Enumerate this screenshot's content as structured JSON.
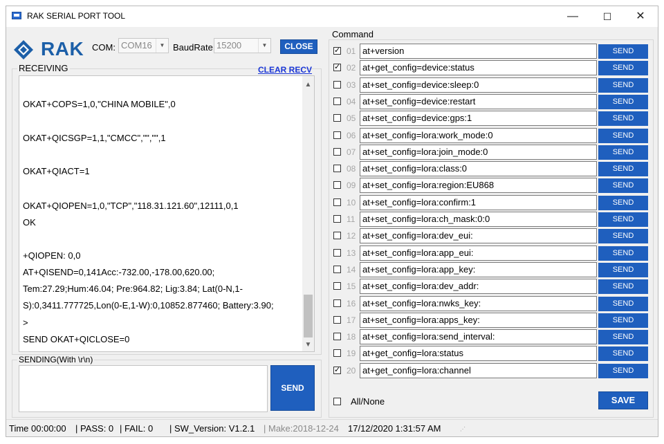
{
  "window": {
    "title": "RAK SERIAL PORT TOOL",
    "controls": {
      "minimize": "—",
      "maximize": "☐",
      "close": "✕"
    }
  },
  "toolbar": {
    "logo_text": "RAK",
    "com_label": "COM:",
    "com_value": "COM16",
    "baud_label": "BaudRate:",
    "baud_value": "15200",
    "close_button": "CLOSE"
  },
  "receiving": {
    "title": "RECEIVING",
    "clear_label": "CLEAR RECV",
    "lines": [
      "OKAT+COPS=1,0,\"CHINA MOBILE\",0",
      "OKAT+QICSGP=1,1,\"CMCC\",\"\",\"\",1",
      "OKAT+QIACT=1",
      "OKAT+QIOPEN=1,0,\"TCP\",\"118.31.121.60\",12111,0,1",
      "OK",
      "+QIOPEN: 0,0",
      "AT+QISEND=0,141Acc:-732.00,-178.00,620.00;",
      "Tem:27.29;Hum:46.04; Pre:964.82; Lig:3.84; Lat(0-N,1-",
      "S):0,3411.777725,Lon(0-E,1-W):0,10852.877460; Battery:3.90;",
      ">",
      "SEND OKAT+QICLOSE=0"
    ]
  },
  "sending": {
    "title": "SENDING(With \\r\\n)",
    "input_value": "",
    "send_button": "SEND"
  },
  "command": {
    "title": "Command",
    "send_label": "SEND",
    "rows": [
      {
        "num": "01",
        "checked": true,
        "cmd": "at+version"
      },
      {
        "num": "02",
        "checked": true,
        "cmd": "at+get_config=device:status"
      },
      {
        "num": "03",
        "checked": false,
        "cmd": "at+set_config=device:sleep:0"
      },
      {
        "num": "04",
        "checked": false,
        "cmd": "at+set_config=device:restart"
      },
      {
        "num": "05",
        "checked": false,
        "cmd": "at+set_config=device:gps:1"
      },
      {
        "num": "06",
        "checked": false,
        "cmd": "at+set_config=lora:work_mode:0"
      },
      {
        "num": "07",
        "checked": false,
        "cmd": "at+set_config=lora:join_mode:0"
      },
      {
        "num": "08",
        "checked": false,
        "cmd": "at+set_config=lora:class:0"
      },
      {
        "num": "09",
        "checked": false,
        "cmd": "at+set_config=lora:region:EU868"
      },
      {
        "num": "10",
        "checked": false,
        "cmd": "at+set_config=lora:confirm:1"
      },
      {
        "num": "11",
        "checked": false,
        "cmd": "at+set_config=lora:ch_mask:0:0"
      },
      {
        "num": "12",
        "checked": false,
        "cmd": "at+set_config=lora:dev_eui:"
      },
      {
        "num": "13",
        "checked": false,
        "cmd": "at+set_config=lora:app_eui:"
      },
      {
        "num": "14",
        "checked": false,
        "cmd": "at+set_config=lora:app_key:"
      },
      {
        "num": "15",
        "checked": false,
        "cmd": "at+set_config=lora:dev_addr:"
      },
      {
        "num": "16",
        "checked": false,
        "cmd": "at+set_config=lora:nwks_key:"
      },
      {
        "num": "17",
        "checked": false,
        "cmd": "at+set_config=lora:apps_key:"
      },
      {
        "num": "18",
        "checked": false,
        "cmd": "at+set_config=lora:send_interval:"
      },
      {
        "num": "19",
        "checked": false,
        "cmd": "at+get_config=lora:status"
      },
      {
        "num": "20",
        "checked": true,
        "cmd": "at+get_config=lora:channel"
      }
    ],
    "all_none_label": "All/None",
    "all_none_checked": false,
    "save_button": "SAVE"
  },
  "status": {
    "time": "Time  00:00:00",
    "pass": "| PASS:  0",
    "fail": "| FAIL:  0",
    "sw_version": "| SW_Version:  V1.2.1",
    "make": "| Make:2018-12-24",
    "datetime": "17/12/2020 1:31:57 AM"
  },
  "colors": {
    "accent": "#1f5fbe",
    "link": "#1a36d6",
    "logo": "#1c5fa8"
  }
}
